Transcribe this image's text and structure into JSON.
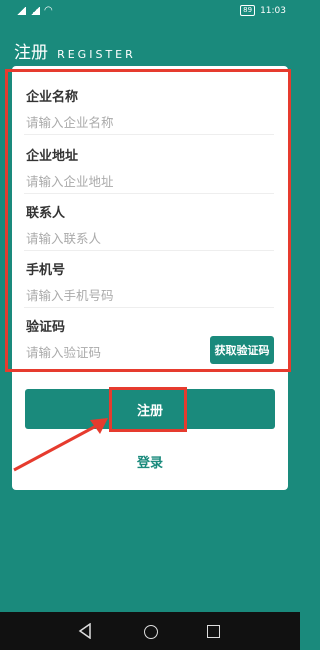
{
  "statusbar": {
    "battery": "89",
    "time": "11:03"
  },
  "header": {
    "title": "注册",
    "subtitle": "REGISTER"
  },
  "form": {
    "fields": [
      {
        "label": "企业名称",
        "placeholder": "请输入企业名称"
      },
      {
        "label": "企业地址",
        "placeholder": "请输入企业地址"
      },
      {
        "label": "联系人",
        "placeholder": "请输入联系人"
      },
      {
        "label": "手机号",
        "placeholder": "请输入手机号码"
      },
      {
        "label": "验证码",
        "placeholder": "请输入验证码"
      }
    ],
    "code_button": "获取验证码"
  },
  "actions": {
    "register": "注册",
    "login": "登录"
  },
  "colors": {
    "primary": "#1a8a7c",
    "highlight": "#e63b2e"
  }
}
